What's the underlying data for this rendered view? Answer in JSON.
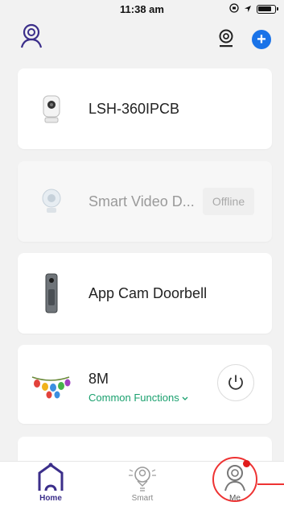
{
  "status_bar": {
    "time": "11:38 am",
    "icons": [
      "lock-rotation-icon",
      "location-arrow-icon",
      "battery-icon"
    ]
  },
  "header": {
    "logo_icon": "person-location-icon",
    "scan_icon": "location-pin-icon",
    "add_icon": "plus-icon",
    "add_label": "+"
  },
  "devices": [
    {
      "name": "LSH-360IPCB",
      "icon": "camera-icon",
      "status": "online"
    },
    {
      "name": "Smart Video D...",
      "icon": "webcam-icon",
      "status": "Offline"
    },
    {
      "name": "App Cam Doorbell",
      "icon": "doorbell-icon",
      "status": "online"
    },
    {
      "name": "8M",
      "icon": "string-lights-icon",
      "subtitle": "Common Functions",
      "action_icon": "power-icon"
    }
  ],
  "tabbar": {
    "tabs": [
      {
        "label": "Home",
        "icon": "home-icon",
        "active": true
      },
      {
        "label": "Smart",
        "icon": "smart-icon",
        "active": false
      },
      {
        "label": "Me",
        "icon": "profile-icon",
        "active": false,
        "notification_dot": true
      }
    ]
  },
  "colors": {
    "accent": "#1a73e8",
    "active_tab": "#3b2e8a",
    "offline_text": "#9a9a9a",
    "link_green": "#1aa06e",
    "alert_red": "#e01b1b"
  }
}
